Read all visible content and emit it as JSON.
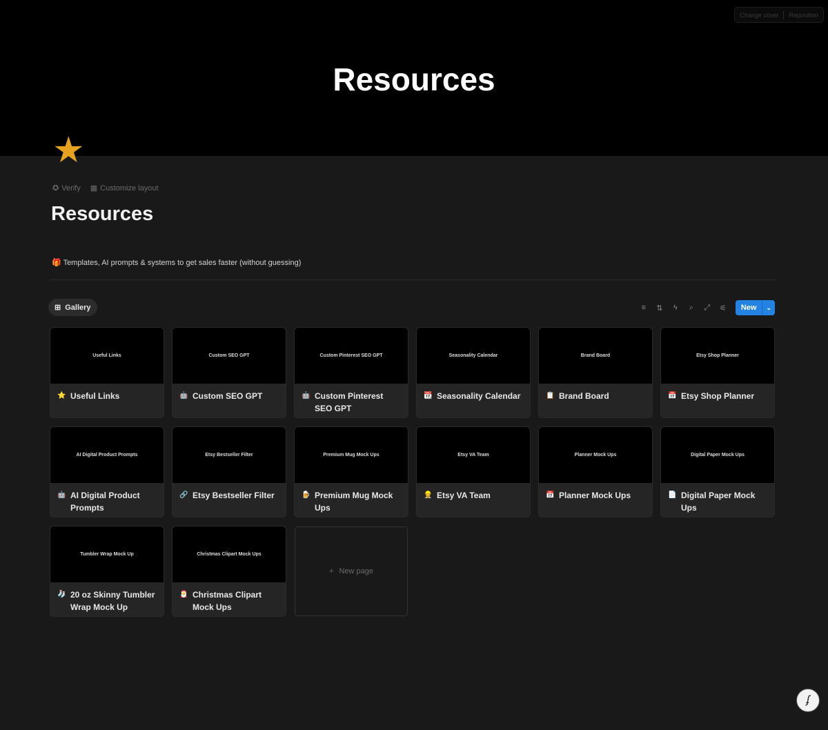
{
  "cover": {
    "title": "Resources",
    "change_cover": "Change cover",
    "reposition": "Reposition"
  },
  "page": {
    "icon": "★",
    "verify": "Verify",
    "customize": "Customize layout",
    "title": "Resources",
    "description_icon": "🎁",
    "description": "Templates, AI prompts & systems to get sales faster (without guessing)"
  },
  "view": {
    "tab": "Gallery",
    "new": "New"
  },
  "cards": [
    {
      "thumb": "Useful Links",
      "icon": "⭐",
      "title": "Useful Links"
    },
    {
      "thumb": "Custom SEO GPT",
      "icon": "🤖",
      "title": "Custom SEO GPT"
    },
    {
      "thumb": "Custom Pinterest SEO GPT",
      "icon": "🤖",
      "title": "Custom Pinterest SEO GPT"
    },
    {
      "thumb": "Seasonality Calendar",
      "icon": "📆",
      "title": "Seasonality Calendar"
    },
    {
      "thumb": "Brand Board",
      "icon": "📋",
      "title": "Brand Board"
    },
    {
      "thumb": "Etsy Shop Planner",
      "icon": "📅",
      "title": "Etsy Shop Planner"
    },
    {
      "thumb": "AI Digital Product Prompts",
      "icon": "🤖",
      "title": "AI Digital Product Prompts"
    },
    {
      "thumb": "Etsy Bestseller Filter",
      "icon": "🔗",
      "title": "Etsy Bestseller Filter"
    },
    {
      "thumb": "Premium Mug Mock Ups",
      "icon": "🍺",
      "title": "Premium Mug Mock Ups"
    },
    {
      "thumb": "Etsy VA Team",
      "icon": "👷",
      "title": "Etsy VA Team"
    },
    {
      "thumb": "Planner Mock Ups",
      "icon": "📅",
      "title": "Planner Mock Ups"
    },
    {
      "thumb": "Digital Paper Mock Ups",
      "icon": "📄",
      "title": "Digital Paper Mock Ups"
    },
    {
      "thumb": "Tumbler Wrap Mock Up",
      "icon": "🧦",
      "title": "20 oz Skinny Tumbler Wrap Mock Up"
    },
    {
      "thumb": "Christmas Clipart Mock Ups",
      "icon": "🎅",
      "title": "Christmas Clipart Mock Ups"
    }
  ],
  "new_page": "New page"
}
